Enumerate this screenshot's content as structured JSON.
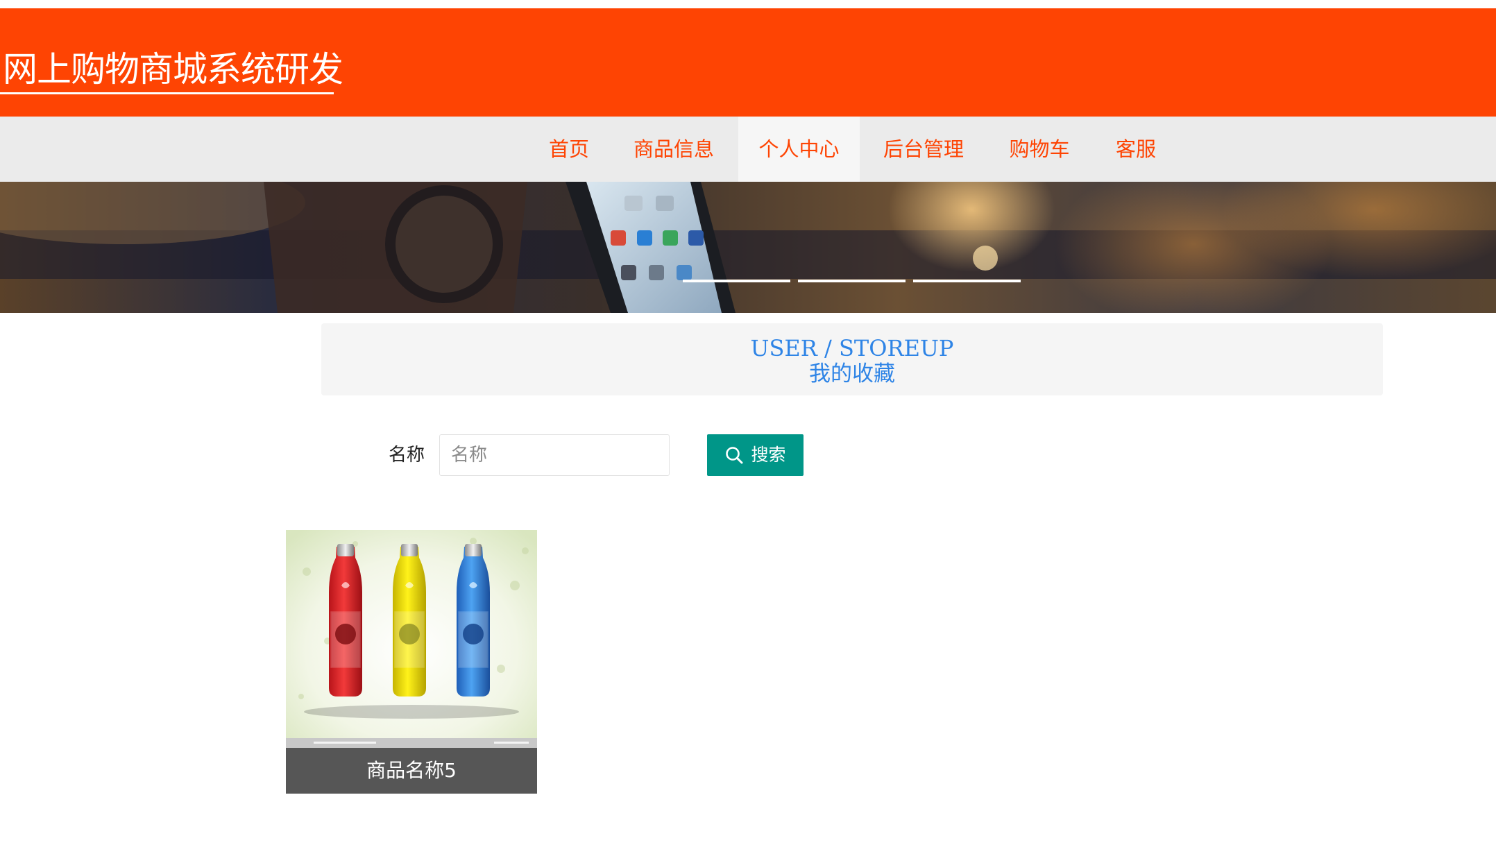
{
  "header": {
    "site_title": "网上购物商城系统研发",
    "background_color": "#fe4403"
  },
  "nav": {
    "items": [
      {
        "label": "首页",
        "active": false
      },
      {
        "label": "商品信息",
        "active": false
      },
      {
        "label": "个人中心",
        "active": true
      },
      {
        "label": "后台管理",
        "active": false
      },
      {
        "label": "购物车",
        "active": false
      },
      {
        "label": "客服",
        "active": false
      }
    ]
  },
  "banner": {
    "slide_count": 3
  },
  "page_heading": {
    "english": "USER / STOREUP",
    "chinese": "我的收藏",
    "color": "#2e84e6"
  },
  "search": {
    "label": "名称",
    "placeholder": "名称",
    "value": "",
    "button_label": "搜索",
    "button_icon": "search-icon",
    "button_color": "#009688"
  },
  "favorites": [
    {
      "name": "商品名称5",
      "image": "three-bottles-product-photo"
    }
  ]
}
